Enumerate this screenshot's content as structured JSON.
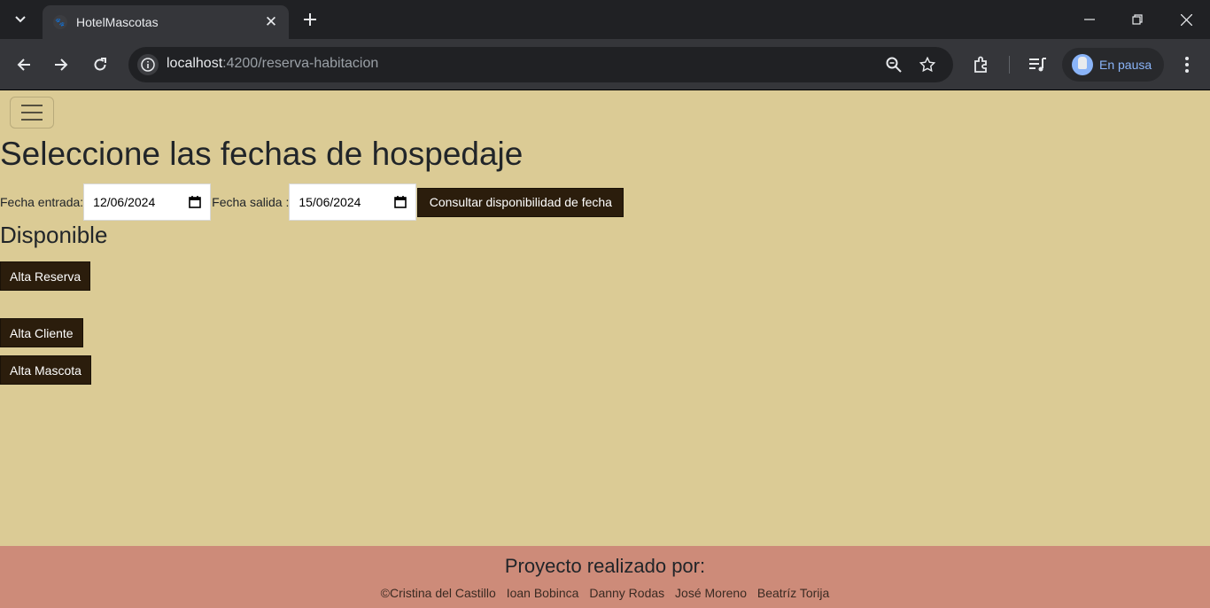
{
  "browser": {
    "tab_title": "HotelMascotas",
    "url_host": "localhost",
    "url_rest": ":4200/reserva-habitacion",
    "profile_label": "En pausa"
  },
  "page": {
    "title": "Seleccione las fechas de hospedaje",
    "fecha_entrada_label": "Fecha entrada:",
    "fecha_entrada_value": "12/06/2024",
    "fecha_salida_label": "Fecha salida :",
    "fecha_salida_value": "15/06/2024",
    "consult_button": "Consultar disponibilidad de fecha",
    "availability": "Disponible",
    "alta_reserva": "Alta Reserva",
    "alta_cliente": "Alta Cliente",
    "alta_mascota": "Alta Mascota"
  },
  "footer": {
    "title": "Proyecto realizado por:",
    "authors": [
      "©Cristina del Castillo",
      "Ioan Bobinca",
      "Danny Rodas",
      "José Moreno",
      "Beatríz Torija"
    ]
  },
  "colors": {
    "page_bg": "#dbcb95",
    "button_bg": "#2b1d0c",
    "footer_bg": "#cd8b79"
  }
}
